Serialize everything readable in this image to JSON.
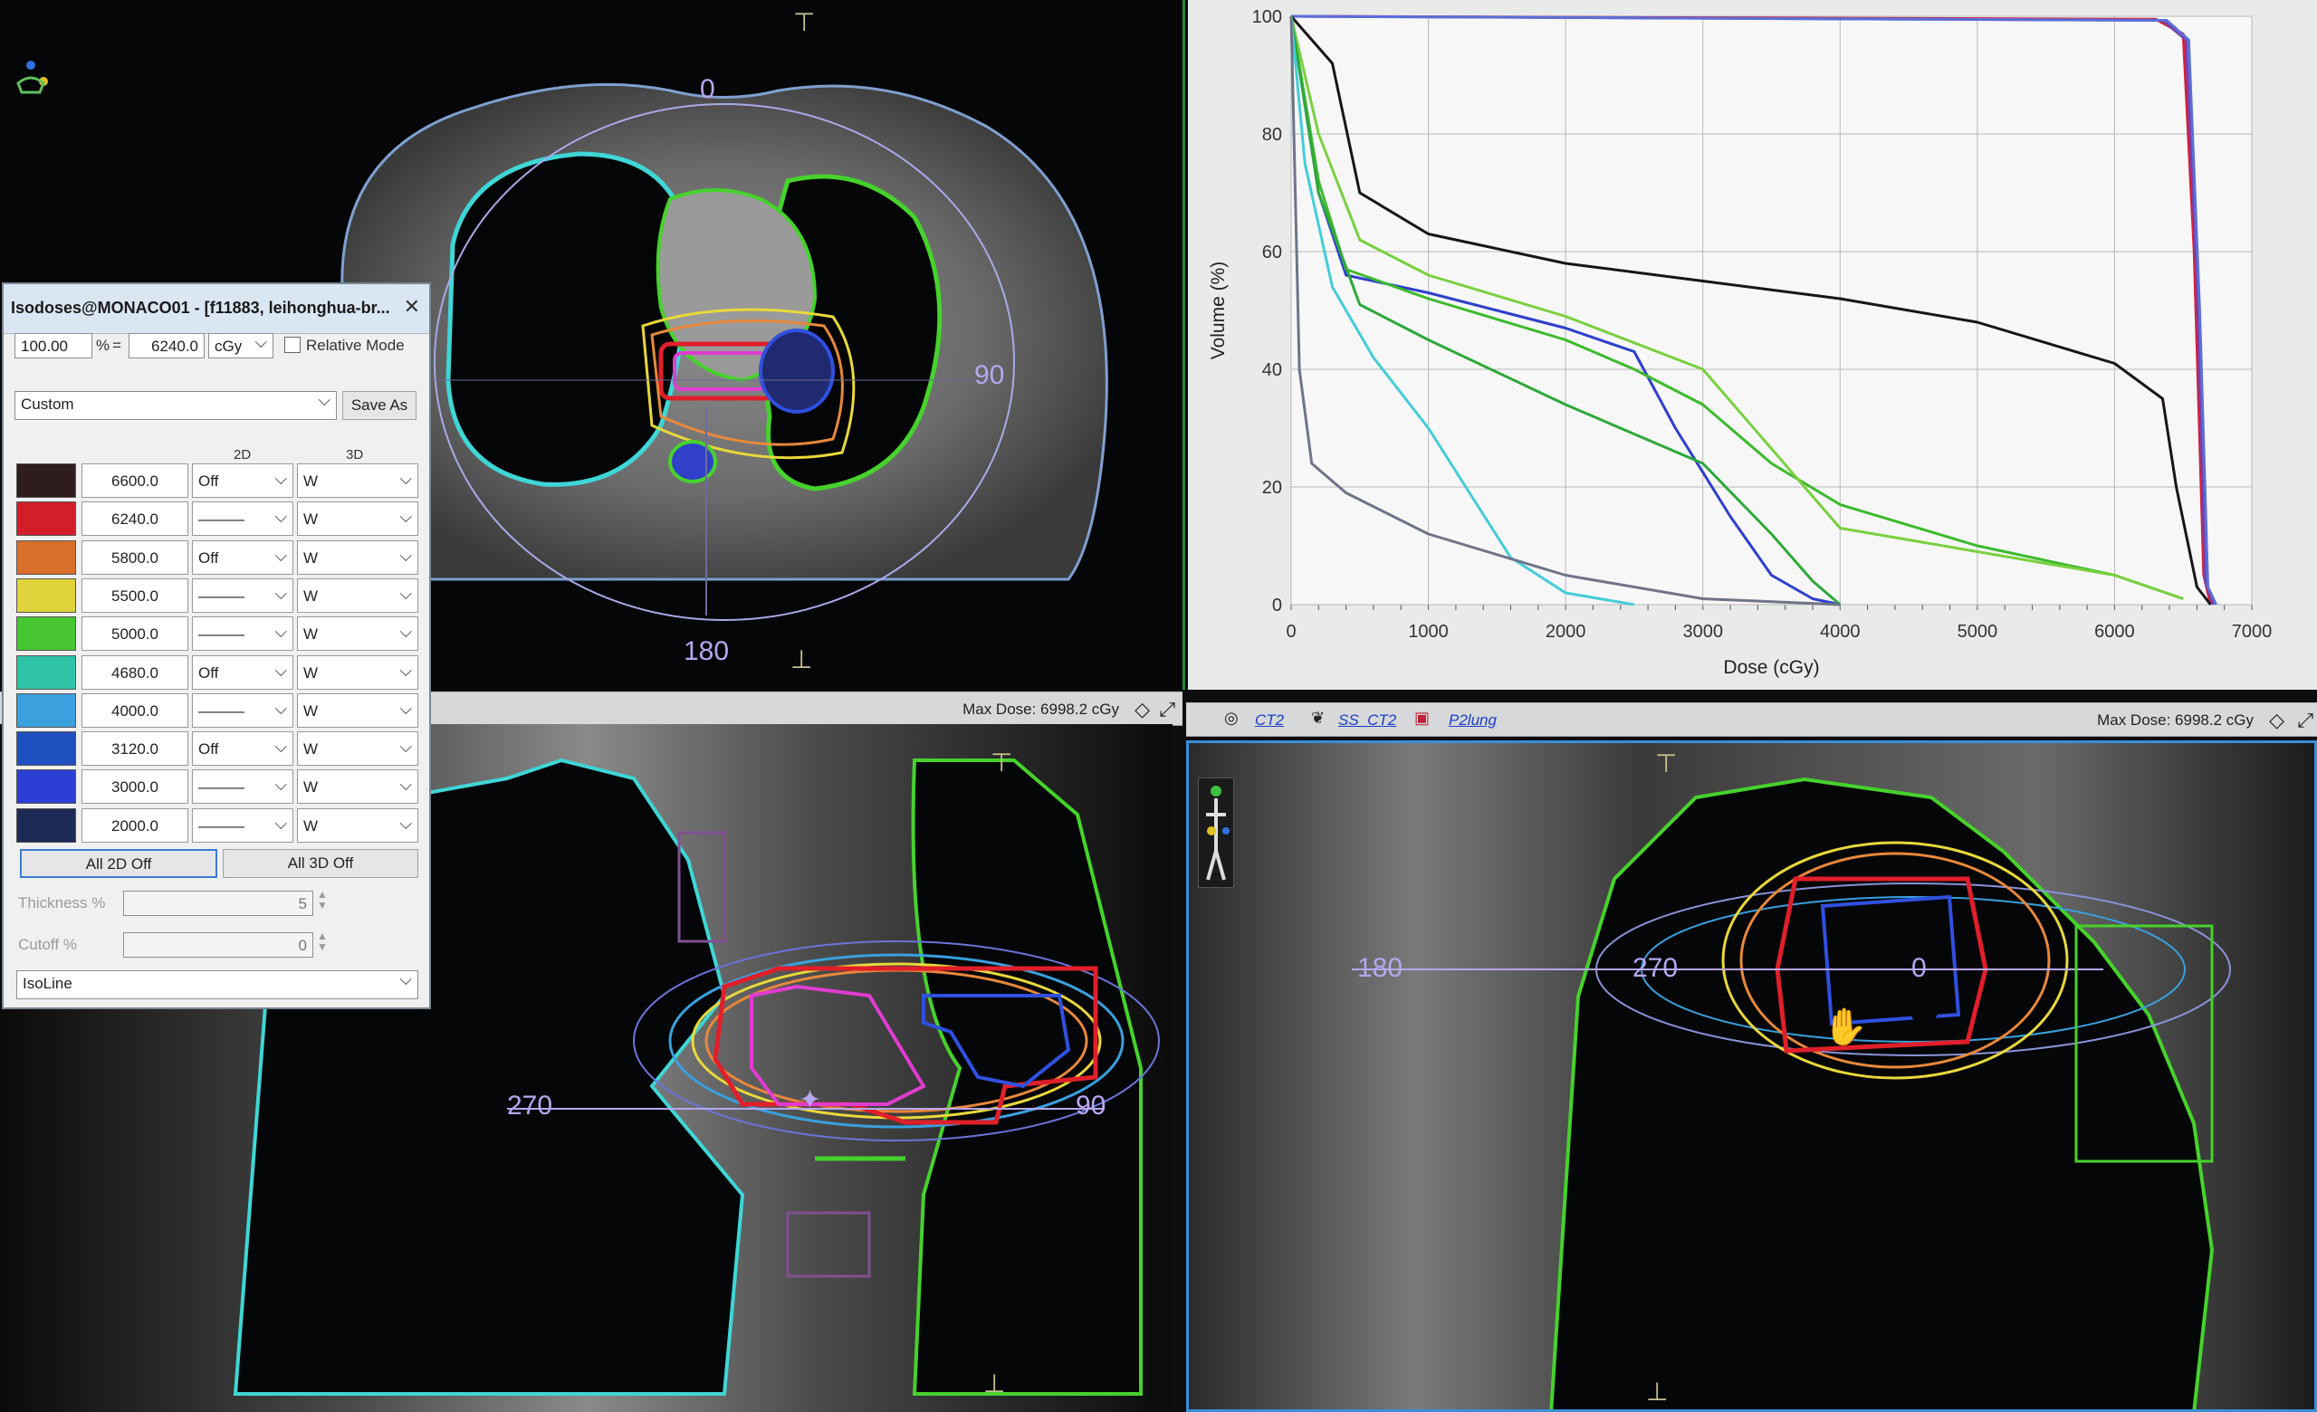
{
  "dialog": {
    "title": "Isodoses@MONACO01 - [f11883, leihonghua-br...",
    "percent_value": "100.00",
    "percent_symbol": "%",
    "equals": "=",
    "dose_value": "6240.0",
    "unit": "cGy",
    "relative_mode_label": "Relative Mode",
    "preset": "Custom",
    "save_as_label": "Save As",
    "col_2d": "2D",
    "col_3d": "3D",
    "rows": [
      {
        "value": "6600.0",
        "color": "#2e1d1c",
        "mode2d": "Off",
        "mode3d": "W"
      },
      {
        "value": "6240.0",
        "color": "#d21e2a",
        "mode2d": "———",
        "mode3d": "W"
      },
      {
        "value": "5800.0",
        "color": "#d8702c",
        "mode2d": "Off",
        "mode3d": "W"
      },
      {
        "value": "5500.0",
        "color": "#e0d23a",
        "mode2d": "———",
        "mode3d": "W"
      },
      {
        "value": "5000.0",
        "color": "#48c632",
        "mode2d": "———",
        "mode3d": "W"
      },
      {
        "value": "4680.0",
        "color": "#2fc4a8",
        "mode2d": "Off",
        "mode3d": "W"
      },
      {
        "value": "4000.0",
        "color": "#3aa0de",
        "mode2d": "———",
        "mode3d": "W"
      },
      {
        "value": "3120.0",
        "color": "#2050c0",
        "mode2d": "Off",
        "mode3d": "W"
      },
      {
        "value": "3000.0",
        "color": "#2b3fd4",
        "mode2d": "———",
        "mode3d": "W"
      },
      {
        "value": "2000.0",
        "color": "#1c2a54",
        "mode2d": "———",
        "mode3d": "W"
      }
    ],
    "all_2d_off": "All 2D Off",
    "all_3d_off": "All 3D Off",
    "thickness_label": "Thickness %",
    "thickness_value": "5",
    "cutoff_label": "Cutoff %",
    "cutoff_value": "0",
    "line_style": "IsoLine"
  },
  "axial": {
    "label_top": "0",
    "label_right": "90",
    "label_bottom": "180"
  },
  "coronal": {
    "label_left": "270",
    "label_right": "90"
  },
  "sagittal": {
    "label_left": "180",
    "label_center": "270",
    "label_right": "0"
  },
  "bars": {
    "coronal_max_dose": "Max Dose: 6998.2 cGy",
    "sagittal_max_dose": "Max Dose: 6998.2 cGy",
    "series": [
      "CT2",
      "SS_CT2",
      "P2lung"
    ]
  },
  "icons": {
    "patient_orientation": "patient-orientation-icon",
    "diamond": "diamond-icon",
    "fullscreen": "fullscreen-icon",
    "hand_cursor": "hand-cursor-icon"
  },
  "chart_data": {
    "type": "line",
    "xlabel": "Dose (cGy)",
    "ylabel": "Volume (%)",
    "xlim": [
      0,
      7000
    ],
    "ylim": [
      0,
      100
    ],
    "xticks": [
      0,
      1000,
      2000,
      3000,
      4000,
      5000,
      6000,
      7000
    ],
    "yticks": [
      0,
      20,
      40,
      60,
      80,
      100
    ],
    "grid": true,
    "series": [
      {
        "color": "#d61f3a",
        "x": [
          0,
          6300,
          6500,
          6580,
          6650,
          6700
        ],
        "y": [
          100,
          99.5,
          97,
          60,
          5,
          0
        ]
      },
      {
        "color": "#7a3fa8",
        "x": [
          0,
          6350,
          6520,
          6600,
          6660,
          6720
        ],
        "y": [
          100,
          99.3,
          96,
          55,
          4,
          0
        ]
      },
      {
        "color": "#5a6fd8",
        "x": [
          0,
          6380,
          6540,
          6620,
          6680,
          6740
        ],
        "y": [
          100,
          99.3,
          96,
          50,
          3,
          0
        ]
      },
      {
        "color": "#1a1418",
        "x": [
          0,
          300,
          500,
          1000,
          2000,
          3000,
          4000,
          5000,
          6000,
          6350,
          6450,
          6600,
          6700
        ],
        "y": [
          100,
          92,
          70,
          63,
          58,
          55,
          52,
          48,
          41,
          35,
          20,
          3,
          0
        ]
      },
      {
        "color": "#2f3fcc",
        "x": [
          0,
          200,
          400,
          1000,
          1500,
          2000,
          2500,
          2800,
          3200,
          3500,
          3800,
          4000
        ],
        "y": [
          100,
          70,
          56,
          53,
          50,
          47,
          43,
          30,
          15,
          5,
          1,
          0
        ]
      },
      {
        "color": "#3cba2c",
        "x": [
          0,
          200,
          400,
          1000,
          2000,
          2500,
          3000,
          3500,
          4000,
          5000,
          6000,
          6500
        ],
        "y": [
          100,
          72,
          57,
          52,
          45,
          40,
          34,
          24,
          17,
          10,
          5,
          1
        ]
      },
      {
        "color": "#7ad040",
        "x": [
          0,
          200,
          500,
          1000,
          2000,
          3000,
          4000,
          5000,
          6000,
          6500
        ],
        "y": [
          100,
          80,
          62,
          56,
          49,
          40,
          13,
          9,
          5,
          1
        ]
      },
      {
        "color": "#2ea83a",
        "x": [
          0,
          200,
          500,
          1000,
          2000,
          3000,
          3500,
          3800,
          4000
        ],
        "y": [
          100,
          70,
          51,
          45,
          34,
          24,
          12,
          4,
          0
        ]
      },
      {
        "color": "#44ccd8",
        "x": [
          0,
          100,
          300,
          600,
          1000,
          1300,
          1600,
          2000,
          2500
        ],
        "y": [
          100,
          75,
          54,
          42,
          30,
          19,
          8,
          2,
          0
        ]
      },
      {
        "color": "#6f7488",
        "x": [
          0,
          60,
          150,
          400,
          1000,
          2000,
          3000,
          4000
        ],
        "y": [
          100,
          40,
          24,
          19,
          12,
          5,
          1,
          0
        ]
      }
    ]
  }
}
